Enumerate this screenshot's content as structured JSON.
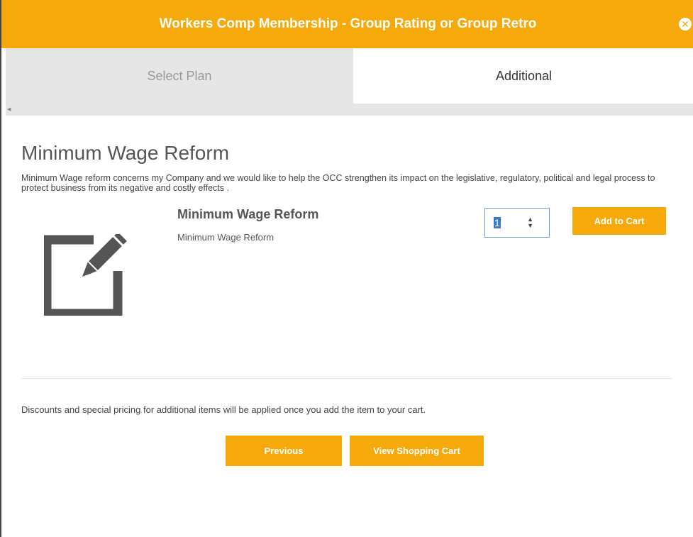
{
  "header": {
    "title": "Workers Comp Membership - Group Rating or Group Retro",
    "close_icon": "circle-x-icon"
  },
  "tabs": [
    {
      "label": "Select Plan",
      "active": false
    },
    {
      "label": "Additional",
      "active": true
    }
  ],
  "section": {
    "title": "Minimum Wage Reform",
    "description": "Minimum Wage reform concerns my Company and we would like to help the OCC strengthen its impact on the legislative, regulatory, political and legal process to protect business from its negative and costly effects ."
  },
  "product": {
    "icon": "edit-pencil-icon",
    "name": "Minimum Wage Reform",
    "subtitle": "Minimum Wage Reform",
    "quantity": "1",
    "add_button": "Add to Cart"
  },
  "footer": {
    "discount_note": "Discounts and special pricing for additional items will be applied once you add the item to your cart.",
    "previous_button": "Previous",
    "view_cart_button": "View Shopping Cart"
  },
  "colors": {
    "accent": "#f5a90b",
    "tab_inactive_bg": "#e6e6e6",
    "focus_border": "#6a9fd8"
  }
}
